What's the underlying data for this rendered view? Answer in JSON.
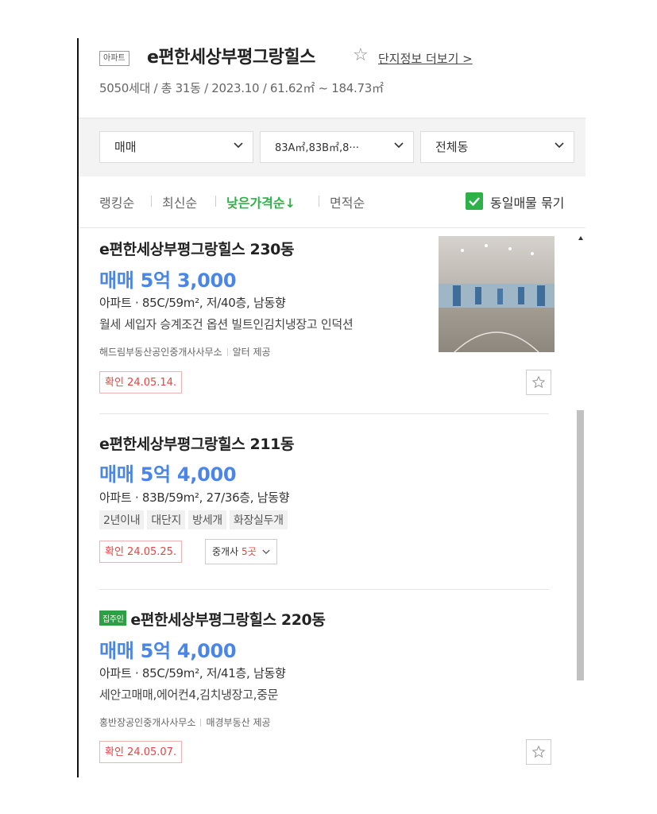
{
  "header": {
    "type_badge": "아파트",
    "complex_name": "e편한세상부평그랑힐스",
    "more_link": "단지정보 더보기 >",
    "complex_info": "5050세대 / 총 31동 / 2023.10 / 61.62㎡ ~ 184.73㎡"
  },
  "filters": {
    "trade_type": "매매",
    "area_type": "83A㎡,83B㎡,8···",
    "building": "전체동"
  },
  "sort": {
    "options": [
      "랭킹순",
      "최신순",
      "낮은가격순↓",
      "면적순"
    ],
    "active_index": 2,
    "group_label": "동일매물 묶기",
    "group_checked": true,
    "accent_color": "#2fb149"
  },
  "listings": [
    {
      "title": "e편한세상부평그랑힐스 230동",
      "owner_badge": "",
      "price": "매매 5억 3,000",
      "spec": "아파트 · 85C/59m², 저/40층, 남동향",
      "desc": "월세 세입자 승계조건 옵션 빌트인김치냉장고 인덕션",
      "agency": "해드림부동산공인중개사사무소",
      "provider": "알터 제공",
      "confirm": "확인 24.05.14.",
      "has_photo": true
    },
    {
      "title": "e편한세상부평그랑힐스 211동",
      "owner_badge": "",
      "price": "매매 5억 4,000",
      "spec": "아파트 · 83B/59m², 27/36층, 남동향",
      "tags": [
        "2년이내",
        "대단지",
        "방세개",
        "화장실두개"
      ],
      "confirm": "확인 24.05.25.",
      "brokers_label": "중개사 ",
      "brokers_count": "5곳"
    },
    {
      "title": "e편한세상부평그랑힐스 220동",
      "owner_badge": "집주인",
      "price": "매매 5억 4,000",
      "spec": "아파트 · 85C/59m², 저/41층, 남동향",
      "desc": "세안고매매,에어컨4,김치냉장고,중문",
      "agency": "홍반장공인중개사사무소",
      "provider": "매경부동산 제공",
      "confirm": "확인 24.05.07."
    }
  ],
  "colors": {
    "price": "#4a86e8",
    "confirm": "#e84343",
    "owner_badge": "#2e9f44"
  }
}
